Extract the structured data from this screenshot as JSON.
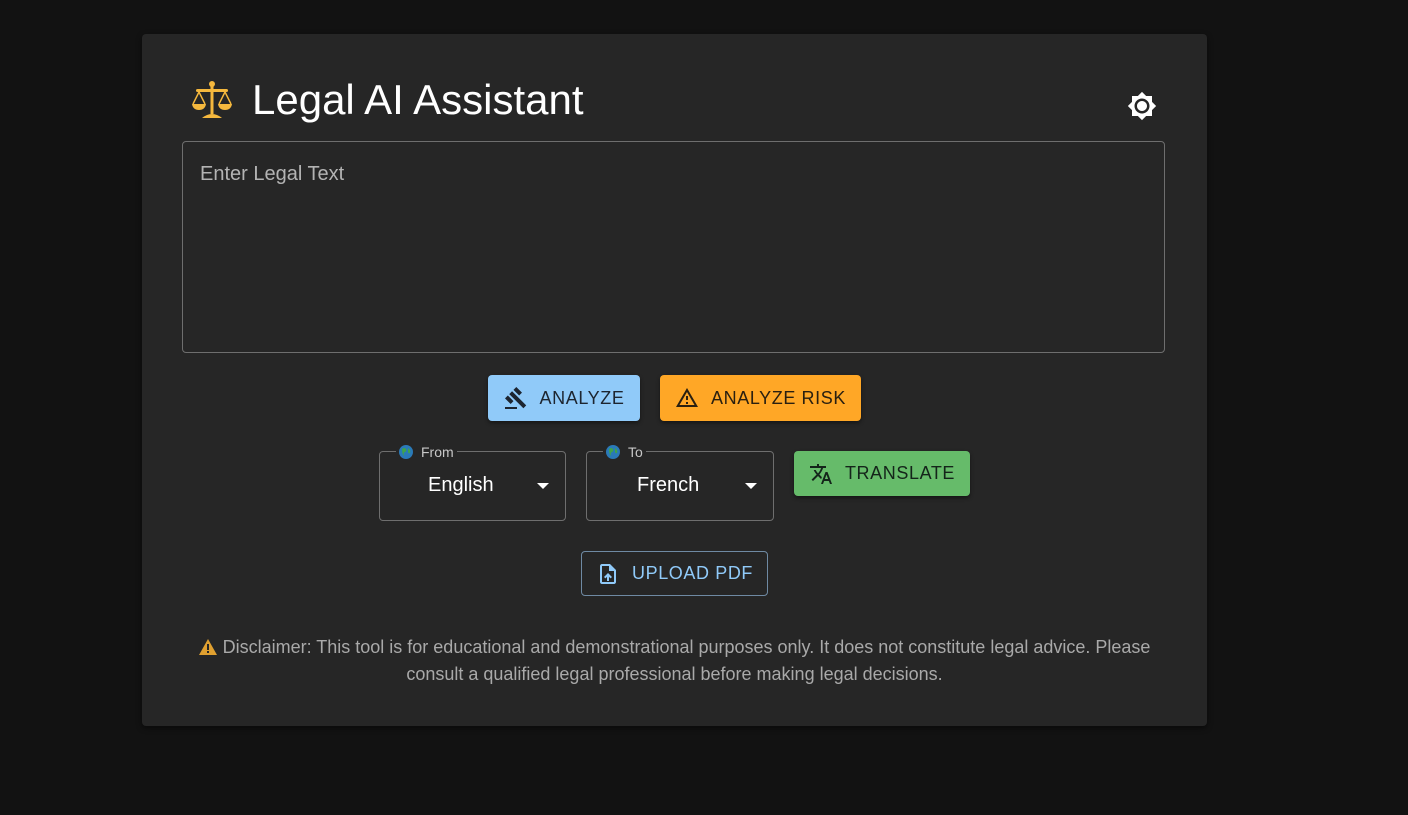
{
  "app": {
    "title": "Legal AI Assistant",
    "logo_icon": "balance-scale-icon",
    "theme_toggle_icon": "brightness-icon"
  },
  "input": {
    "placeholder": "Enter Legal Text",
    "value": ""
  },
  "actions": {
    "analyze_label": "Analyze",
    "analyze_icon": "gavel-icon",
    "analyze_risk_label": "Analyze Risk",
    "analyze_risk_icon": "warning-icon",
    "translate_label": "Translate",
    "translate_icon": "translate-icon",
    "upload_label": "Upload PDF",
    "upload_icon": "file-upload-icon"
  },
  "translation": {
    "from_label": "From",
    "from_value": "English",
    "to_label": "To",
    "to_value": "French"
  },
  "disclaimer": {
    "text": "Disclaimer: This tool is for educational and demonstrational purposes only. It does not constitute legal advice. Please consult a qualified legal professional before making legal decisions."
  },
  "colors": {
    "page_bg": "#121212",
    "card_bg": "#262626",
    "analyze": "#90caf9",
    "analyze_risk": "#ffa726",
    "translate": "#66bb6a",
    "upload_text": "#90caf9"
  }
}
